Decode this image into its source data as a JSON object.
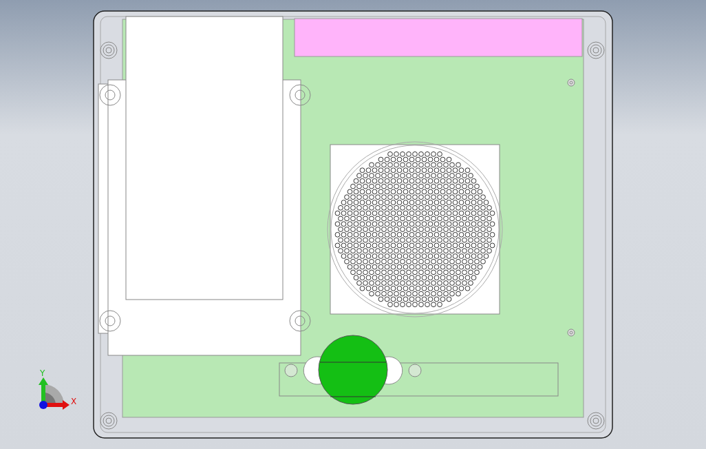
{
  "viewport": {
    "axis_labels": {
      "y": "Y",
      "x": "X"
    }
  }
}
